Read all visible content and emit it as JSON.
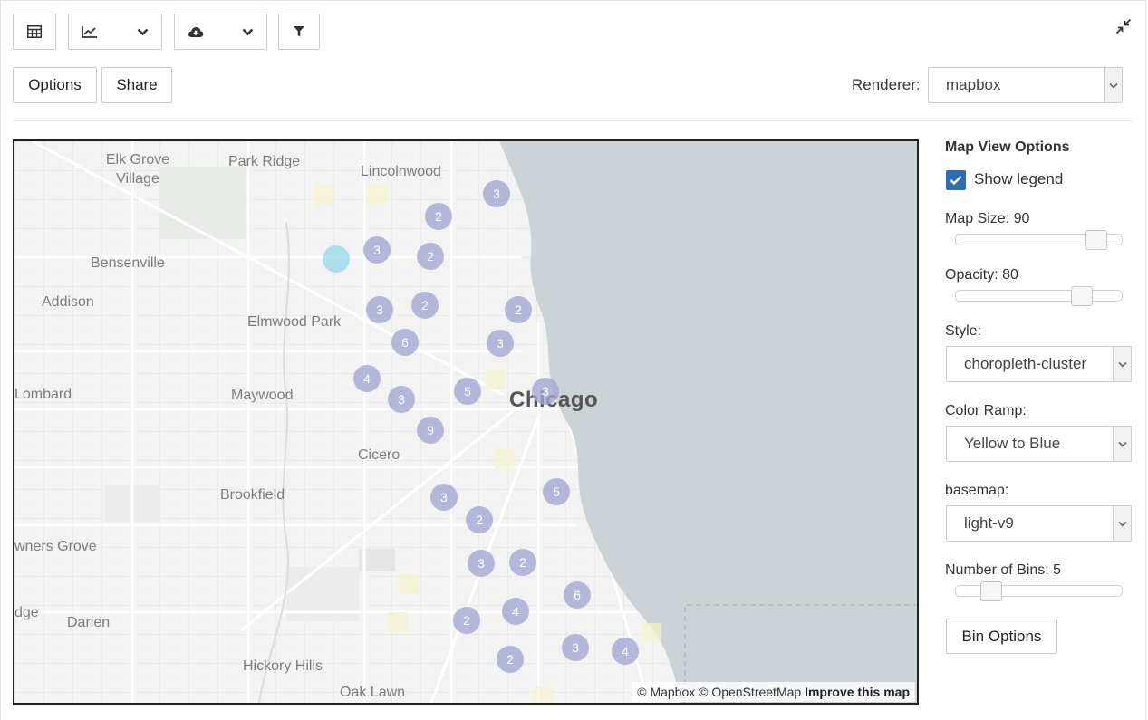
{
  "toolbar": {
    "table_icon": "table-icon",
    "chart_icon": "line-chart-icon",
    "download_icon": "cloud-download-icon",
    "filter_icon": "filter-icon",
    "expand_icon": "compress-icon"
  },
  "actions": {
    "options_label": "Options",
    "share_label": "Share"
  },
  "renderer": {
    "label": "Renderer:",
    "value": "mapbox"
  },
  "map": {
    "places": [
      "Elk Grove Village",
      "Park Ridge",
      "Lincolnwood",
      "Bensenville",
      "Addison",
      "Elmwood Park",
      "Lombard",
      "Maywood",
      "Chicago",
      "Cicero",
      "Brookfield",
      "wners Grove",
      "Darien",
      "dge",
      "Hickory Hills",
      "Oak Lawn"
    ],
    "clusters": [
      "3",
      "2",
      "3",
      "2",
      "3",
      "2",
      "2",
      "6",
      "3",
      "4",
      "5",
      "3",
      "3",
      "9",
      "5",
      "3",
      "2",
      "3",
      "2",
      "6",
      "4",
      "2",
      "3",
      "4",
      "2"
    ],
    "attribution": {
      "mapbox": "© Mapbox",
      "osm": "© OpenStreetMap",
      "improve": "Improve this map"
    }
  },
  "panel": {
    "title": "Map View Options",
    "show_legend": {
      "label": "Show legend",
      "checked": true
    },
    "map_size": {
      "label": "Map Size: 90",
      "value": 90,
      "min": 0,
      "max": 100
    },
    "opacity": {
      "label": "Opacity: 80",
      "value": 80,
      "min": 0,
      "max": 100
    },
    "style": {
      "label": "Style:",
      "value": "choropleth-cluster"
    },
    "color_ramp": {
      "label": "Color Ramp:",
      "value": "Yellow to Blue"
    },
    "basemap": {
      "label": "basemap:",
      "value": "light-v9"
    },
    "bins": {
      "label": "Number of Bins: 5",
      "value": 5,
      "min": 0,
      "max": 30
    },
    "bin_options_label": "Bin Options"
  },
  "colors": {
    "accent": "#2f6cb0",
    "cluster": "#a0a5d2",
    "water": "#ccd3d6",
    "land": "#f3f3f3"
  }
}
